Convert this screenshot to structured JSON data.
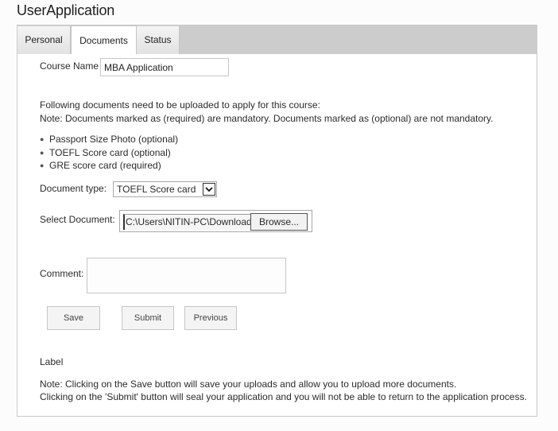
{
  "app": {
    "title": "UserApplication"
  },
  "tabs": [
    {
      "label": "Personal",
      "active": false
    },
    {
      "label": "Documents",
      "active": true
    },
    {
      "label": "Status",
      "active": false
    }
  ],
  "form": {
    "course_name": {
      "label": "Course Name",
      "value": "MBA Application"
    },
    "intro": {
      "line1": "Following documents need to be uploaded to apply for this course:",
      "line2": "Note: Documents marked as (required) are mandatory. Documents marked as (optional) are not mandatory."
    },
    "documents_list": [
      "Passport Size Photo (optional)",
      "TOEFL Score card (optional)",
      "GRE score card (required)"
    ],
    "document_type": {
      "label": "Document type:",
      "selected": "TOEFL Score card"
    },
    "select_document": {
      "label": "Select Document:",
      "path": "C:\\Users\\NITIN-PC\\Downloads",
      "browse_label": "Browse..."
    },
    "comment": {
      "label": "Comment:",
      "value": ""
    },
    "buttons": {
      "save": "Save",
      "submit": "Submit",
      "previous": "Previous"
    },
    "status_label": "Label",
    "notes": {
      "line1": "Note: Clicking on the Save button will save your uploads and allow you to upload more documents.",
      "line2": "Clicking on the 'Submit' button will seal your application and you will not be able to return to the application process."
    }
  },
  "icons": {
    "dropdown": "chevron-down-icon",
    "bullet": "bullet-dot"
  },
  "colors": {
    "tabbar_bg": "#cccccc",
    "panel_border": "#c8c8c8",
    "page_bg": "#fcfcfc"
  }
}
